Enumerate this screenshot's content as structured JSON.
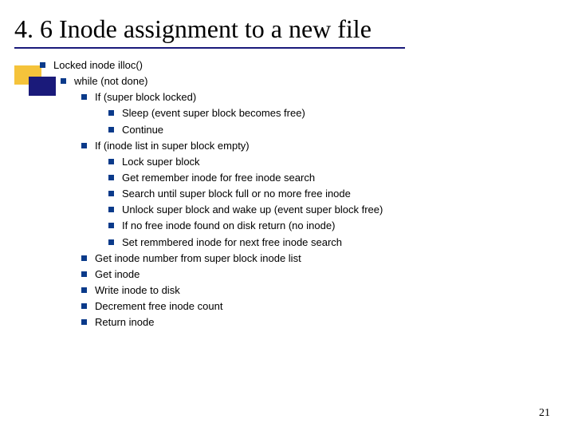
{
  "title": "4. 6 Inode assignment to a new file",
  "lines": {
    "l0": "Locked inode illoc()",
    "l1": "while (not done)",
    "l2": "If (super block locked)",
    "l3": "Sleep (event super block becomes free)",
    "l4": "Continue",
    "l5": "If (inode list in super block empty)",
    "l6": "Lock super block",
    "l7": "Get remember inode for free inode search",
    "l8": "Search until super block full or no more free inode",
    "l9": "Unlock super block and wake up (event super block free)",
    "l10": "If no free inode found on disk return (no inode)",
    "l11": "Set remmbered inode for next free inode search",
    "l12": "Get inode number from super block inode list",
    "l13": "Get inode",
    "l14": "Write inode to disk",
    "l15": "Decrement free inode count",
    "l16": "Return inode"
  },
  "page_number": "21"
}
